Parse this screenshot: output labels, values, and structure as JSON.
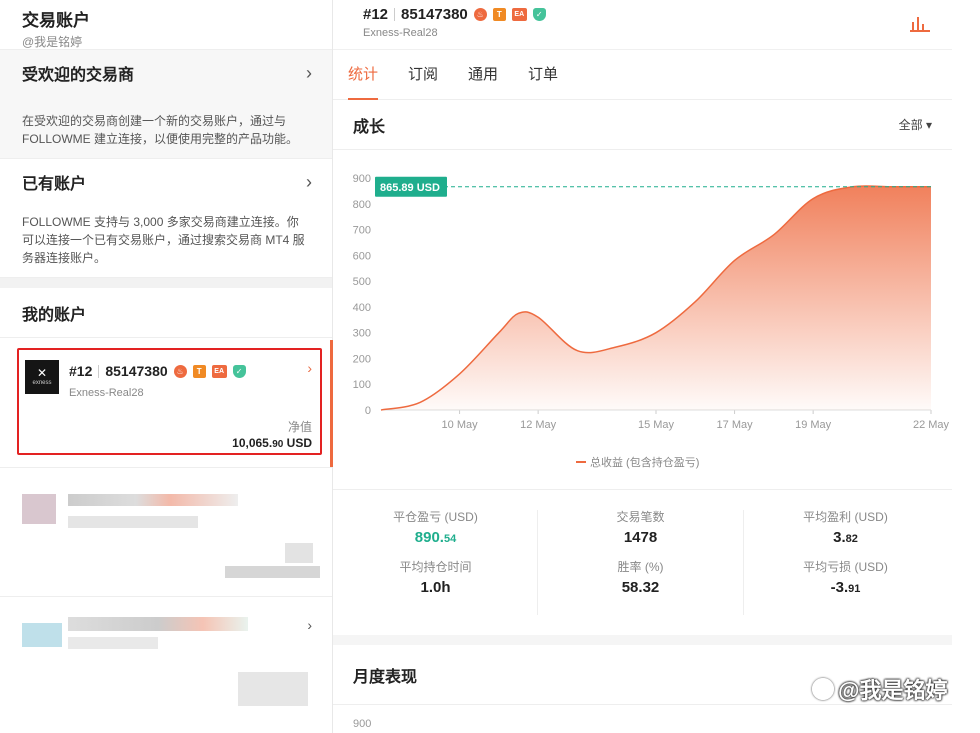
{
  "left": {
    "title": "交易账户",
    "handle": "@我是铭婷",
    "popular": {
      "label": "受欢迎的交易商",
      "desc": "在受欢迎的交易商创建一个新的交易账户，通过与 FOLLOWME 建立连接，以便使用完整的产品功能。"
    },
    "existing": {
      "label": "已有账户",
      "desc": "FOLLOWME 支持与 3,000 多家交易商建立连接。你可以连接一个已有交易账户，通过搜索交易商 MT4 服务器连接账户。"
    },
    "my_accounts_title": "我的账户",
    "account": {
      "index": "#12",
      "number": "85147380",
      "server": "Exness-Real28",
      "equity_label": "净值",
      "equity_main": "10,065.",
      "equity_decimals": "90",
      "equity_unit": "USD",
      "logo_text": "exness"
    }
  },
  "header": {
    "index": "#12",
    "number": "85147380",
    "server": "Exness-Real28"
  },
  "tabs": [
    {
      "label": "统计",
      "active": true
    },
    {
      "label": "订阅",
      "active": false
    },
    {
      "label": "通用",
      "active": false
    },
    {
      "label": "订单",
      "active": false
    }
  ],
  "growth": {
    "title": "成长",
    "filter": "全部",
    "marker_label": "865.89 USD",
    "legend": "总收益 (包含持仓盈亏)"
  },
  "chart_data": {
    "type": "area",
    "x": [
      "8 May",
      "9 May",
      "10 May",
      "11 May",
      "11.5 May",
      "12 May",
      "13 May",
      "14 May",
      "15 May",
      "16 May",
      "17 May",
      "18 May",
      "19 May",
      "20 May",
      "21 May",
      "22 May"
    ],
    "y": [
      0,
      30,
      140,
      300,
      375,
      360,
      230,
      245,
      300,
      420,
      580,
      680,
      820,
      866,
      866,
      866
    ],
    "xticks": [
      "10 May",
      "12 May",
      "15 May",
      "17 May",
      "19 May",
      "22 May"
    ],
    "yticks": [
      "0",
      "100",
      "200",
      "300",
      "400",
      "500",
      "600",
      "700",
      "800",
      "900"
    ],
    "ylim": [
      0,
      900
    ],
    "marker_value": 865.89,
    "series_name": "总收益 (包含持仓盈亏)",
    "color": "#ee6a3f"
  },
  "stats": [
    {
      "label": "平仓盈亏 (USD)",
      "main": "890.",
      "dec": "54",
      "green": true
    },
    {
      "label": "交易笔数",
      "main": "1478",
      "dec": "",
      "green": false
    },
    {
      "label": "平均盈利 (USD)",
      "main": "3.",
      "dec": "82",
      "green": false
    },
    {
      "label": "平均持仓时间",
      "main": "1.0h",
      "dec": "",
      "green": false
    },
    {
      "label": "胜率 (%)",
      "main": "58.32",
      "dec": "",
      "green": false
    },
    {
      "label": "平均亏损 (USD)",
      "main": "-3.",
      "dec": "91",
      "green": false
    }
  ],
  "monthly": {
    "title": "月度表现",
    "first_tick": "900"
  },
  "watermark": "@我是铭婷",
  "colors": {
    "accent": "#ee6a3f",
    "green": "#1fae8d",
    "highlight": "#e32222"
  }
}
